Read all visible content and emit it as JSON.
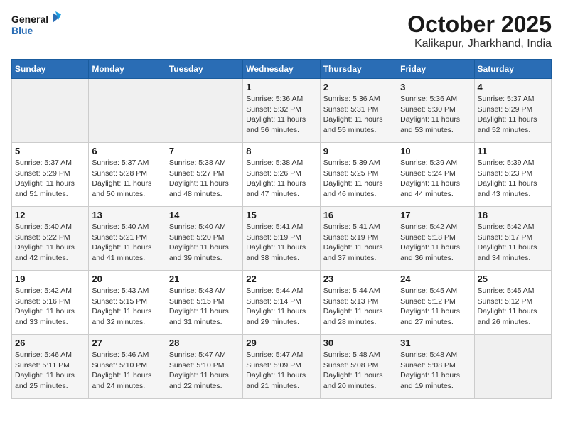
{
  "header": {
    "logo_line1": "General",
    "logo_line2": "Blue",
    "month_year": "October 2025",
    "location": "Kalikapur, Jharkhand, India"
  },
  "weekdays": [
    "Sunday",
    "Monday",
    "Tuesday",
    "Wednesday",
    "Thursday",
    "Friday",
    "Saturday"
  ],
  "weeks": [
    [
      {
        "day": "",
        "info": ""
      },
      {
        "day": "",
        "info": ""
      },
      {
        "day": "",
        "info": ""
      },
      {
        "day": "1",
        "info": "Sunrise: 5:36 AM\nSunset: 5:32 PM\nDaylight: 11 hours and 56 minutes."
      },
      {
        "day": "2",
        "info": "Sunrise: 5:36 AM\nSunset: 5:31 PM\nDaylight: 11 hours and 55 minutes."
      },
      {
        "day": "3",
        "info": "Sunrise: 5:36 AM\nSunset: 5:30 PM\nDaylight: 11 hours and 53 minutes."
      },
      {
        "day": "4",
        "info": "Sunrise: 5:37 AM\nSunset: 5:29 PM\nDaylight: 11 hours and 52 minutes."
      }
    ],
    [
      {
        "day": "5",
        "info": "Sunrise: 5:37 AM\nSunset: 5:29 PM\nDaylight: 11 hours and 51 minutes."
      },
      {
        "day": "6",
        "info": "Sunrise: 5:37 AM\nSunset: 5:28 PM\nDaylight: 11 hours and 50 minutes."
      },
      {
        "day": "7",
        "info": "Sunrise: 5:38 AM\nSunset: 5:27 PM\nDaylight: 11 hours and 48 minutes."
      },
      {
        "day": "8",
        "info": "Sunrise: 5:38 AM\nSunset: 5:26 PM\nDaylight: 11 hours and 47 minutes."
      },
      {
        "day": "9",
        "info": "Sunrise: 5:39 AM\nSunset: 5:25 PM\nDaylight: 11 hours and 46 minutes."
      },
      {
        "day": "10",
        "info": "Sunrise: 5:39 AM\nSunset: 5:24 PM\nDaylight: 11 hours and 44 minutes."
      },
      {
        "day": "11",
        "info": "Sunrise: 5:39 AM\nSunset: 5:23 PM\nDaylight: 11 hours and 43 minutes."
      }
    ],
    [
      {
        "day": "12",
        "info": "Sunrise: 5:40 AM\nSunset: 5:22 PM\nDaylight: 11 hours and 42 minutes."
      },
      {
        "day": "13",
        "info": "Sunrise: 5:40 AM\nSunset: 5:21 PM\nDaylight: 11 hours and 41 minutes."
      },
      {
        "day": "14",
        "info": "Sunrise: 5:40 AM\nSunset: 5:20 PM\nDaylight: 11 hours and 39 minutes."
      },
      {
        "day": "15",
        "info": "Sunrise: 5:41 AM\nSunset: 5:19 PM\nDaylight: 11 hours and 38 minutes."
      },
      {
        "day": "16",
        "info": "Sunrise: 5:41 AM\nSunset: 5:19 PM\nDaylight: 11 hours and 37 minutes."
      },
      {
        "day": "17",
        "info": "Sunrise: 5:42 AM\nSunset: 5:18 PM\nDaylight: 11 hours and 36 minutes."
      },
      {
        "day": "18",
        "info": "Sunrise: 5:42 AM\nSunset: 5:17 PM\nDaylight: 11 hours and 34 minutes."
      }
    ],
    [
      {
        "day": "19",
        "info": "Sunrise: 5:42 AM\nSunset: 5:16 PM\nDaylight: 11 hours and 33 minutes."
      },
      {
        "day": "20",
        "info": "Sunrise: 5:43 AM\nSunset: 5:15 PM\nDaylight: 11 hours and 32 minutes."
      },
      {
        "day": "21",
        "info": "Sunrise: 5:43 AM\nSunset: 5:15 PM\nDaylight: 11 hours and 31 minutes."
      },
      {
        "day": "22",
        "info": "Sunrise: 5:44 AM\nSunset: 5:14 PM\nDaylight: 11 hours and 29 minutes."
      },
      {
        "day": "23",
        "info": "Sunrise: 5:44 AM\nSunset: 5:13 PM\nDaylight: 11 hours and 28 minutes."
      },
      {
        "day": "24",
        "info": "Sunrise: 5:45 AM\nSunset: 5:12 PM\nDaylight: 11 hours and 27 minutes."
      },
      {
        "day": "25",
        "info": "Sunrise: 5:45 AM\nSunset: 5:12 PM\nDaylight: 11 hours and 26 minutes."
      }
    ],
    [
      {
        "day": "26",
        "info": "Sunrise: 5:46 AM\nSunset: 5:11 PM\nDaylight: 11 hours and 25 minutes."
      },
      {
        "day": "27",
        "info": "Sunrise: 5:46 AM\nSunset: 5:10 PM\nDaylight: 11 hours and 24 minutes."
      },
      {
        "day": "28",
        "info": "Sunrise: 5:47 AM\nSunset: 5:10 PM\nDaylight: 11 hours and 22 minutes."
      },
      {
        "day": "29",
        "info": "Sunrise: 5:47 AM\nSunset: 5:09 PM\nDaylight: 11 hours and 21 minutes."
      },
      {
        "day": "30",
        "info": "Sunrise: 5:48 AM\nSunset: 5:08 PM\nDaylight: 11 hours and 20 minutes."
      },
      {
        "day": "31",
        "info": "Sunrise: 5:48 AM\nSunset: 5:08 PM\nDaylight: 11 hours and 19 minutes."
      },
      {
        "day": "",
        "info": ""
      }
    ]
  ]
}
